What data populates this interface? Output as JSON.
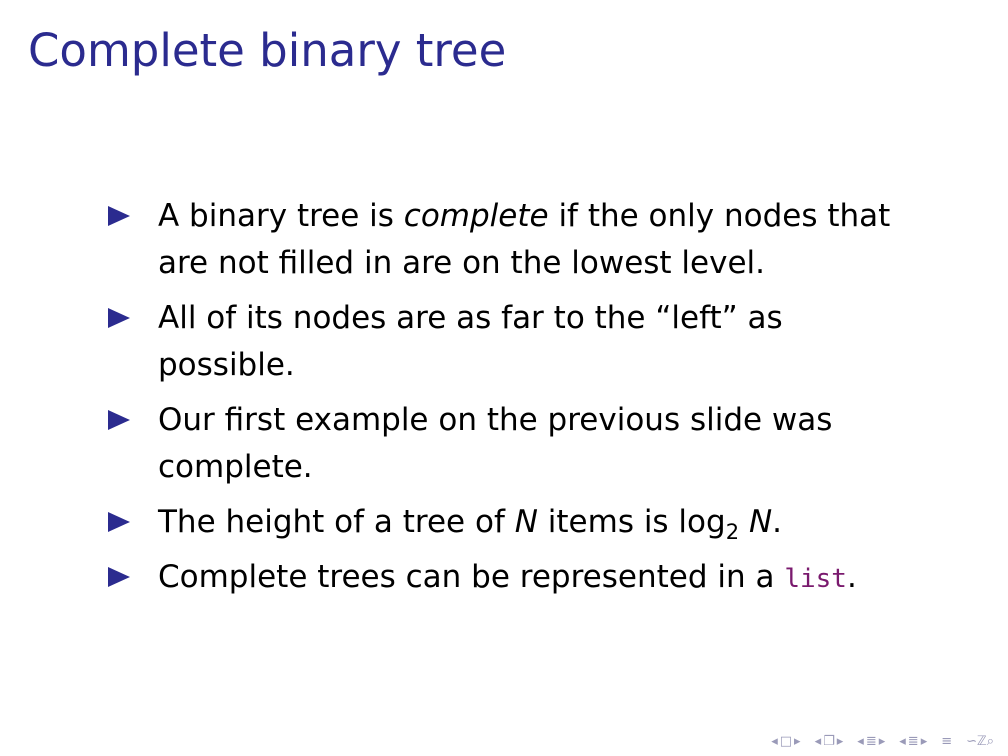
{
  "slide": {
    "title": "Complete binary tree",
    "bullets": [
      {
        "line1_pre": "A binary tree is ",
        "line1_em": "complete",
        "line1_post": " if the only nodes that",
        "line2": "are not filled in are on the lowest level."
      },
      {
        "line1": "All of its nodes are as far to the “left” as",
        "line2": "possible."
      },
      {
        "line1": "Our first example on the previous slide was",
        "line2": "complete."
      },
      {
        "pre": "The height of a tree of ",
        "var_n": "N",
        "mid": " items is log",
        "sub": "2",
        "space": " ",
        "var_n2": "N",
        "post": "."
      },
      {
        "pre": "Complete trees can be represented in a ",
        "code": "list",
        "post": "."
      }
    ]
  },
  "nav": {
    "frame_prev": "◂",
    "frame_box": "□",
    "frame_next": "▸",
    "sub_prev": "◂",
    "sub_box": "❐",
    "sub_next": "▸",
    "sec_prev": "◂",
    "sec_box": "≣",
    "sec_next": "▸",
    "part_prev": "◂",
    "part_box": "≣",
    "part_next": "▸",
    "align": "≡",
    "search": "∽ℤ⌕"
  },
  "colors": {
    "title": "#2b2b8f",
    "bullet": "#2b2b8f",
    "code": "#7a1a6e",
    "nav": "#9a9ab8"
  }
}
